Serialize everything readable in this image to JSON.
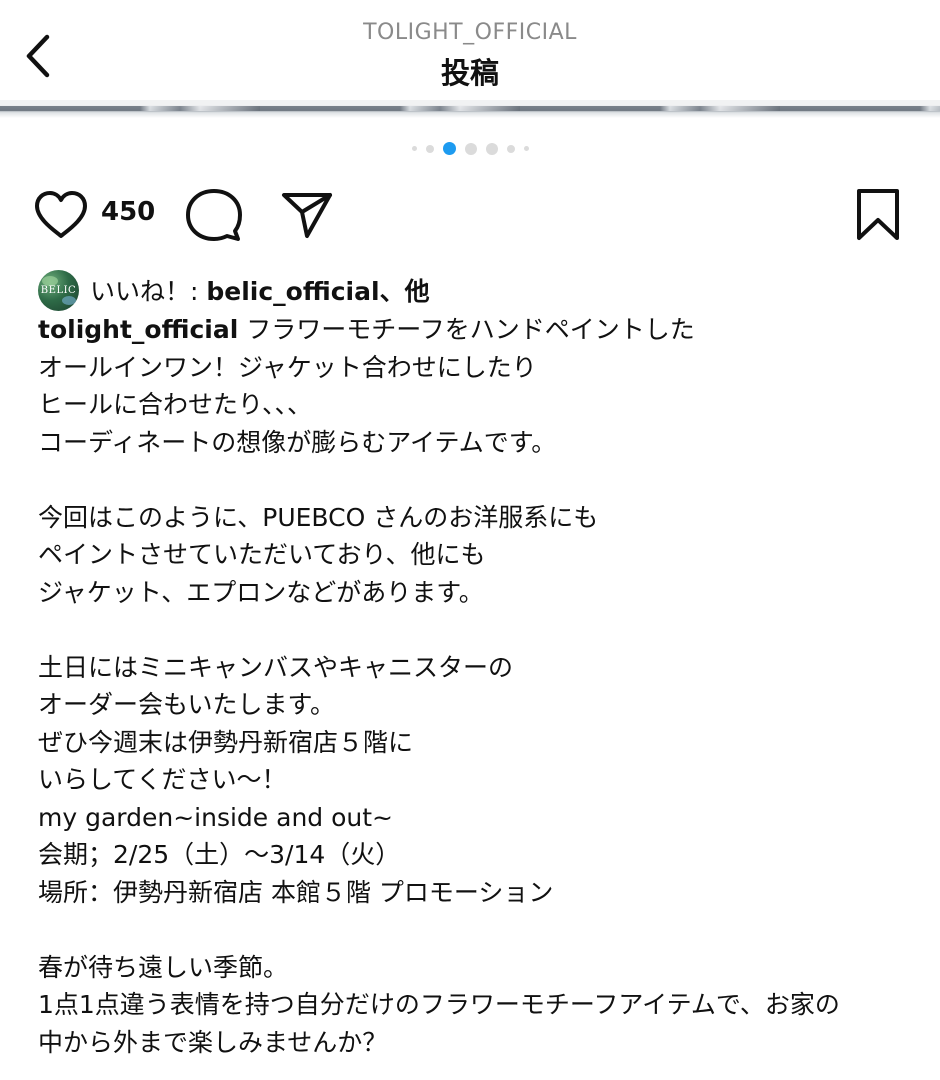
{
  "header": {
    "account_name": "TOLIGHT_OFFICIAL",
    "title": "投稿"
  },
  "carousel": {
    "dot_count": 7,
    "active_index": 2
  },
  "actions": {
    "like_count": "450"
  },
  "likes": {
    "avatar_text": "BELIC",
    "prefix": "いいね！: ",
    "user": "belic_official",
    "suffix": "、他"
  },
  "caption": {
    "user": "tolight_official",
    "first_line_text": "フラワーモチーフをハンドペイントした",
    "lines": [
      "オールインワン！ジャケット合わせにしたり",
      "ヒールに合わせたり、、、",
      "コーディネートの想像が膨らむアイテムです。",
      "",
      "今回はこのように、PUEBCO さんのお洋服系にも",
      "ペイントさせていただいており、他にも",
      "ジャケット、エプロンなどがあります。",
      "",
      "土日にはミニキャンバスやキャニスターの",
      "オーダー会もいたします。",
      "ぜひ今週末は伊勢丹新宿店５階に",
      "いらしてください〜！",
      "my garden~inside and out~",
      "会期；2/25（土）〜3/14（火）",
      "場所：伊勢丹新宿店 本館５階 プロモーション",
      "",
      "春が待ち遠しい季節。",
      "1点1点違う表情を持つ自分だけのフラワーモチーフアイテムで、お家の",
      "中から外まで楽しみませんか？"
    ]
  },
  "colors": {
    "accent_dot": "#1d9bf0",
    "text": "#111111",
    "muted": "#8a8a8a"
  },
  "icons": {
    "back": "chevron-left-icon",
    "like": "heart-icon",
    "comment": "comment-icon",
    "share": "send-icon",
    "save": "bookmark-icon"
  }
}
